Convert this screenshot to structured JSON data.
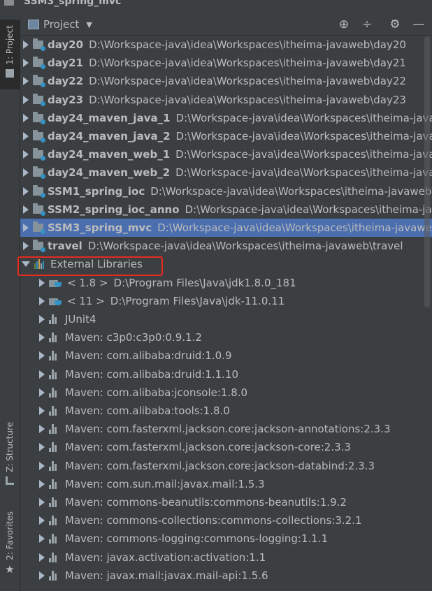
{
  "window": {
    "title": "SSM3_spring_mvc"
  },
  "left_tabs": [
    {
      "label": "1: Project"
    },
    {
      "label": "Z: Structure"
    },
    {
      "label": "2: Favorites"
    }
  ],
  "toolbar": {
    "view_label": "Project",
    "buttons": [
      "crosshair-icon",
      "collapse-icon",
      "gear-icon",
      "minimize-icon"
    ]
  },
  "tree": {
    "modules": [
      {
        "name": "day20",
        "path": "D:\\Workspace-java\\idea\\Workspaces\\itheima-javaweb\\day20"
      },
      {
        "name": "day21",
        "path": "D:\\Workspace-java\\idea\\Workspaces\\itheima-javaweb\\day21"
      },
      {
        "name": "day22",
        "path": "D:\\Workspace-java\\idea\\Workspaces\\itheima-javaweb\\day22"
      },
      {
        "name": "day23",
        "path": "D:\\Workspace-java\\idea\\Workspaces\\itheima-javaweb\\day23"
      },
      {
        "name": "day24_maven_java_1",
        "path": "D:\\Workspace-java\\idea\\Workspaces\\itheima-javaw"
      },
      {
        "name": "day24_maven_java_2",
        "path": "D:\\Workspace-java\\idea\\Workspaces\\itheima-javaw"
      },
      {
        "name": "day24_maven_web_1",
        "path": "D:\\Workspace-java\\idea\\Workspaces\\itheima-javaw"
      },
      {
        "name": "day24_maven_web_2",
        "path": "D:\\Workspace-java\\idea\\Workspaces\\itheima-javaw"
      },
      {
        "name": "SSM1_spring_ioc",
        "path": "D:\\Workspace-java\\idea\\Workspaces\\itheima-javaweb\\S"
      },
      {
        "name": "SSM2_spring_ioc_anno",
        "path": "D:\\Workspace-java\\idea\\Workspaces\\itheima-java"
      },
      {
        "name": "SSM3_spring_mvc",
        "path": "D:\\Workspace-java\\idea\\Workspaces\\itheima-javaweb\\"
      },
      {
        "name": "travel",
        "path": "D:\\Workspace-java\\idea\\Workspaces\\itheima-javaweb\\travel"
      }
    ],
    "selected_module": "SSM3_spring_mvc",
    "external_libraries_label": "External Libraries",
    "jdks": [
      {
        "name": "< 1.8 >",
        "path": "D:\\Program Files\\Java\\jdk1.8.0_181"
      },
      {
        "name": "< 11 >",
        "path": "D:\\Program Files\\Java\\jdk-11.0.11"
      }
    ],
    "libraries": [
      "JUnit4",
      "Maven: c3p0:c3p0:0.9.1.2",
      "Maven: com.alibaba:druid:1.0.9",
      "Maven: com.alibaba:druid:1.1.10",
      "Maven: com.alibaba:jconsole:1.8.0",
      "Maven: com.alibaba:tools:1.8.0",
      "Maven: com.fasterxml.jackson.core:jackson-annotations:2.3.3",
      "Maven: com.fasterxml.jackson.core:jackson-core:2.3.3",
      "Maven: com.fasterxml.jackson.core:jackson-databind:2.3.3",
      "Maven: com.sun.mail:javax.mail:1.5.3",
      "Maven: commons-beanutils:commons-beanutils:1.9.2",
      "Maven: commons-collections:commons-collections:3.2.1",
      "Maven: commons-logging:commons-logging:1.1.1",
      "Maven: javax.activation:activation:1.1",
      "Maven: javax.mail:javax.mail-api:1.5.6"
    ]
  },
  "colors": {
    "selection": "#4b6eaf",
    "highlight_box": "#e52a1f",
    "folder_badge": "#3592c4"
  }
}
